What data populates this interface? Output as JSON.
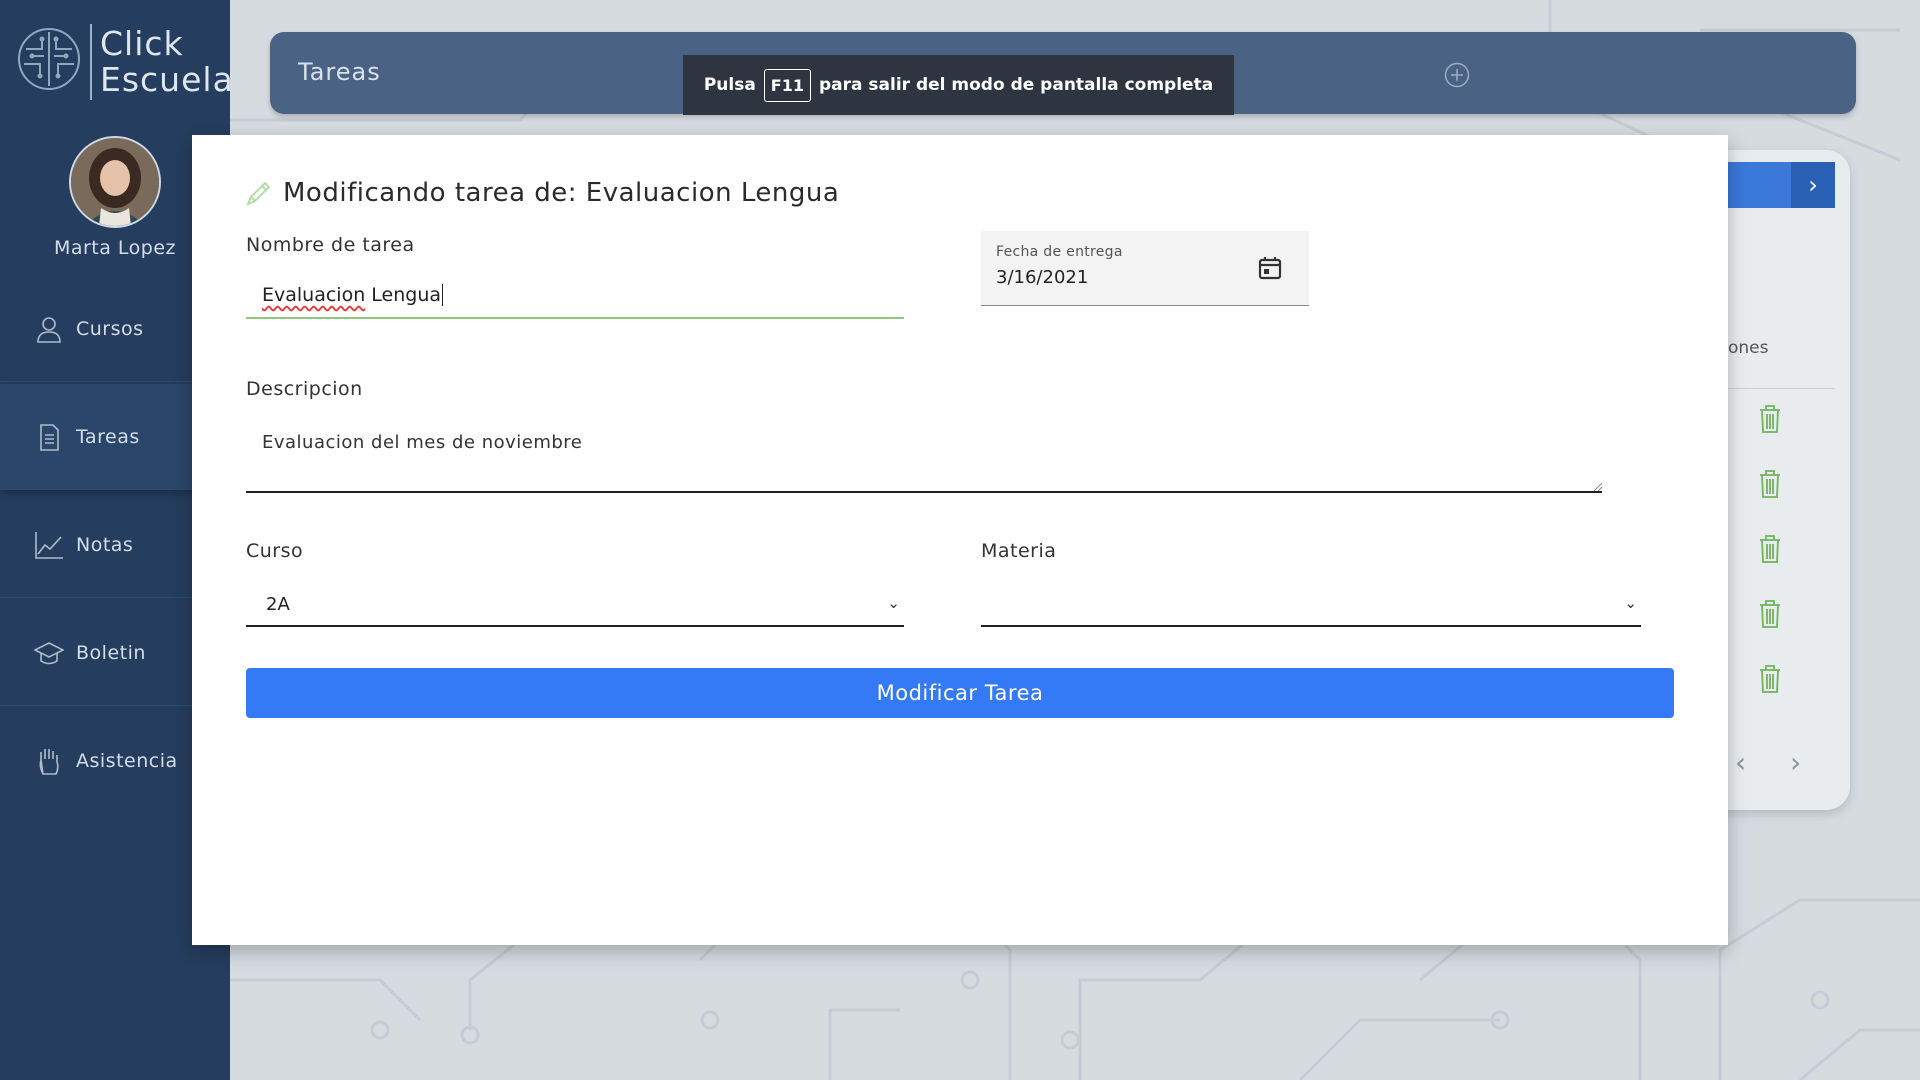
{
  "app": {
    "logo_line1": "Click",
    "logo_line2": "Escuela",
    "user_name": "Marta Lopez"
  },
  "sidebar": {
    "items": [
      {
        "label": "Cursos",
        "icon": "user-icon"
      },
      {
        "label": "Tareas",
        "icon": "document-icon",
        "active": true
      },
      {
        "label": "Notas",
        "icon": "line-chart-icon"
      },
      {
        "label": "Boletin",
        "icon": "graduation-cap-icon"
      },
      {
        "label": "Asistencia",
        "icon": "hand-icon"
      }
    ]
  },
  "header": {
    "title": "Tareas"
  },
  "toast": {
    "prefix": "Pulsa",
    "key": "F11",
    "suffix": "para salir del modo de pantalla completa"
  },
  "background_card": {
    "partial_text": "ones",
    "trash_count": 5
  },
  "modal": {
    "title": "Modificando tarea de: Evaluacion Lengua",
    "name_label": "Nombre de tarea",
    "name_value_word1": "Evaluacion",
    "name_value_word2": "Lengua",
    "date_label": "Fecha de entrega",
    "date_value": "3/16/2021",
    "description_label": "Descripcion",
    "description_value": "Evaluacion del mes de noviembre",
    "course_label": "Curso",
    "course_value": "2A",
    "subject_label": "Materia",
    "subject_value": "",
    "submit_label": "Modificar Tarea"
  },
  "colors": {
    "sidebar_bg": "#253d5e",
    "header_bg": "#4a6283",
    "primary_button": "#3479f6",
    "input_focus": "#8cc97a",
    "trash_green": "#6fb35a"
  }
}
